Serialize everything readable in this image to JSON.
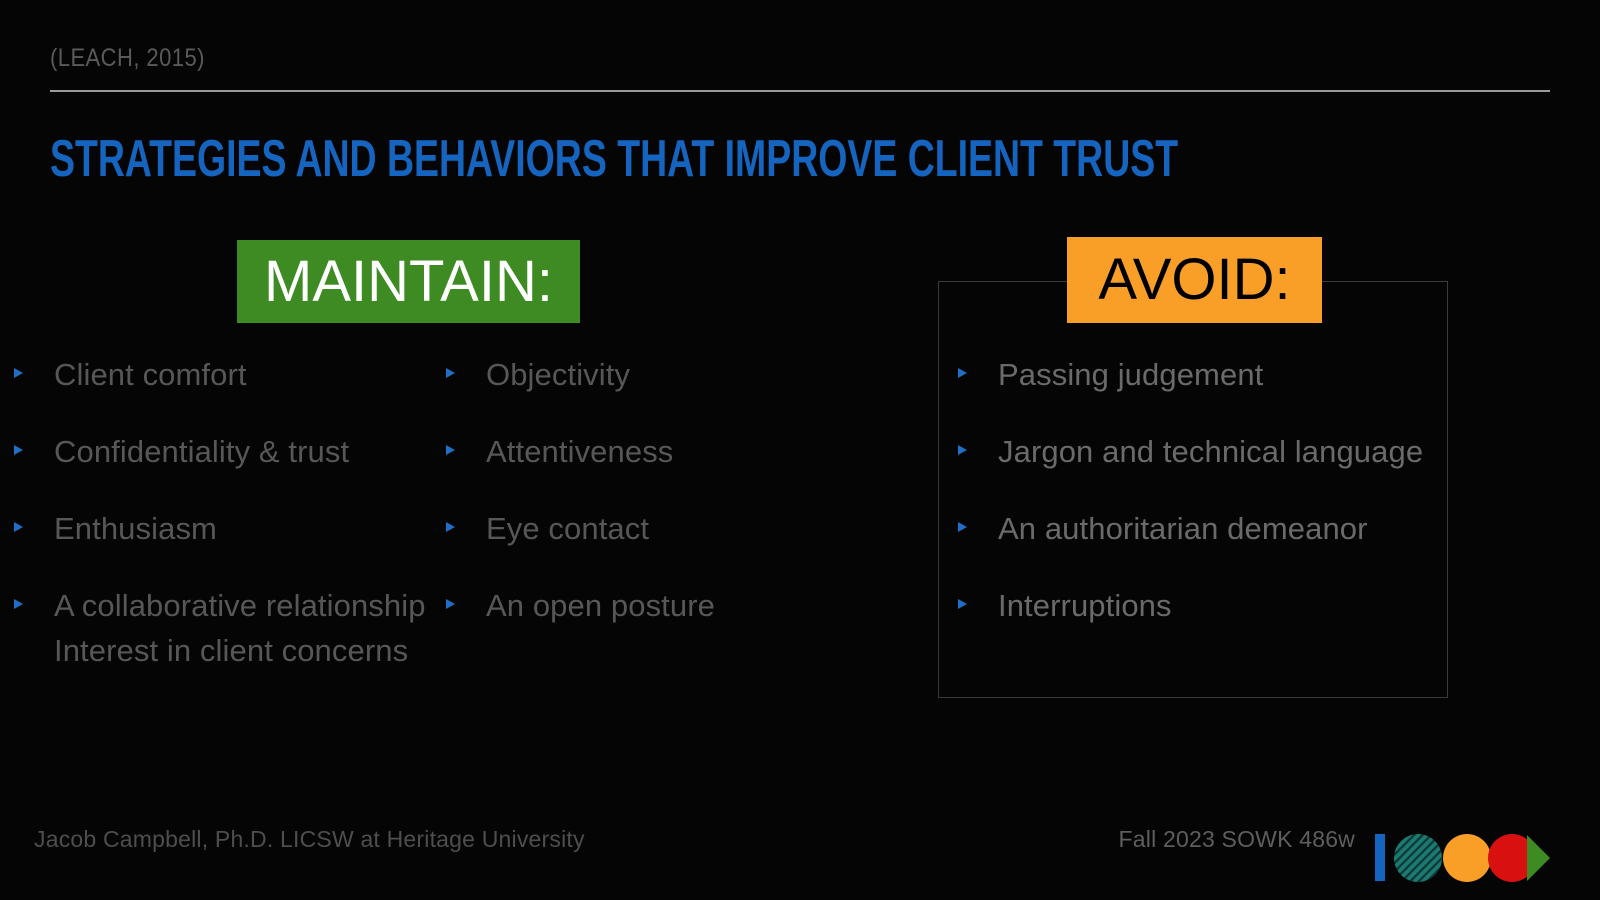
{
  "slide": {
    "citation": "(LEACH, 2015)",
    "title": "STRATEGIES AND BEHAVIORS THAT IMPROVE CLIENT TRUST",
    "background_color": "#050505",
    "title_color": "#1565c0",
    "rule_color": "#9a9a9a"
  },
  "maintain": {
    "heading": "MAINTAIN:",
    "heading_bg": "#3d8b22",
    "heading_text_color": "#ffffff",
    "column_one": [
      "Client comfort",
      "Confidentiality & trust",
      "Enthusiasm",
      "A collaborative relationship Interest in client concerns"
    ],
    "column_two": [
      "Objectivity",
      "Attentiveness",
      "Eye contact",
      "An open posture"
    ]
  },
  "avoid": {
    "heading": "AVOID:",
    "heading_bg": "#f99f27",
    "heading_text_color": "#000000",
    "panel_border_color": "#3a3a3a",
    "items": [
      "Passing judgement",
      "Jargon and technical language",
      "An authoritarian demeanor",
      "Interruptions"
    ]
  },
  "footer": {
    "left": "Jacob Campbell, Ph.D. LICSW at Heritage University",
    "right": "Fall 2023 SOWK 486w"
  },
  "logo": {
    "name": "heritage-university-logo",
    "bar_color": "#1565c0",
    "striped_circle_color": "#1c7a72",
    "orange_circle_color": "#f99f27",
    "red_circle_color": "#d81010",
    "triangle_color": "#3d8b22"
  },
  "bullet": {
    "marker_color": "#1f6fc4",
    "text_color": "#575757",
    "text_color_avoid": "#6a6a6a"
  }
}
